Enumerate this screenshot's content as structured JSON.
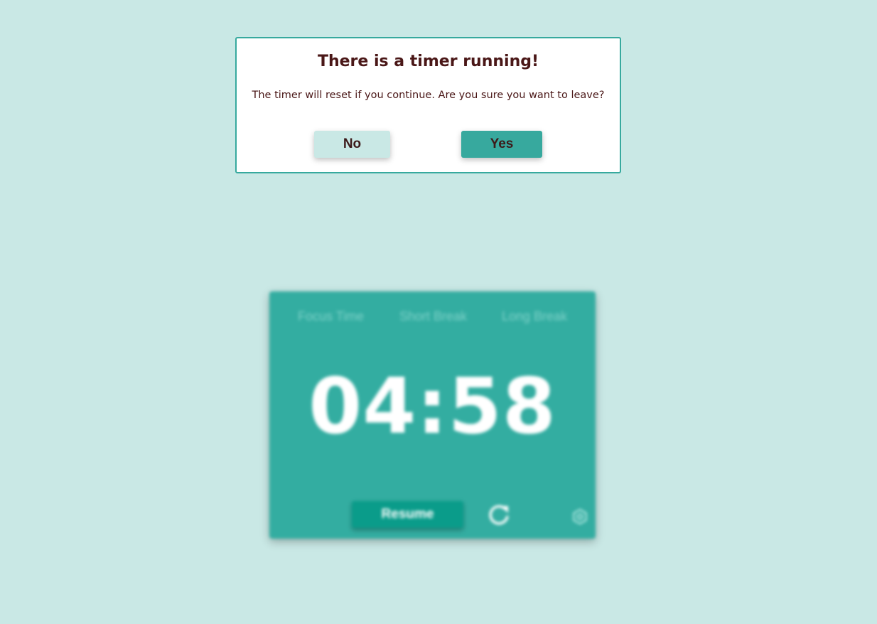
{
  "dialog": {
    "title": "There is a timer running!",
    "message": "The timer will reset if you continue. Are you sure you want to leave?",
    "no_label": "No",
    "yes_label": "Yes"
  },
  "timer": {
    "tabs": [
      {
        "label": "Focus Time"
      },
      {
        "label": "Short Break"
      },
      {
        "label": "Long Break"
      }
    ],
    "time": "04:58",
    "resume_label": "Resume",
    "icons": {
      "reset": "reset-icon",
      "settings": "settings-icon"
    }
  },
  "colors": {
    "background": "#c9e8e5",
    "accent": "#37a99e",
    "card": "#33ada1",
    "resume": "#0a9c8a",
    "text_dark": "#4a1717"
  }
}
